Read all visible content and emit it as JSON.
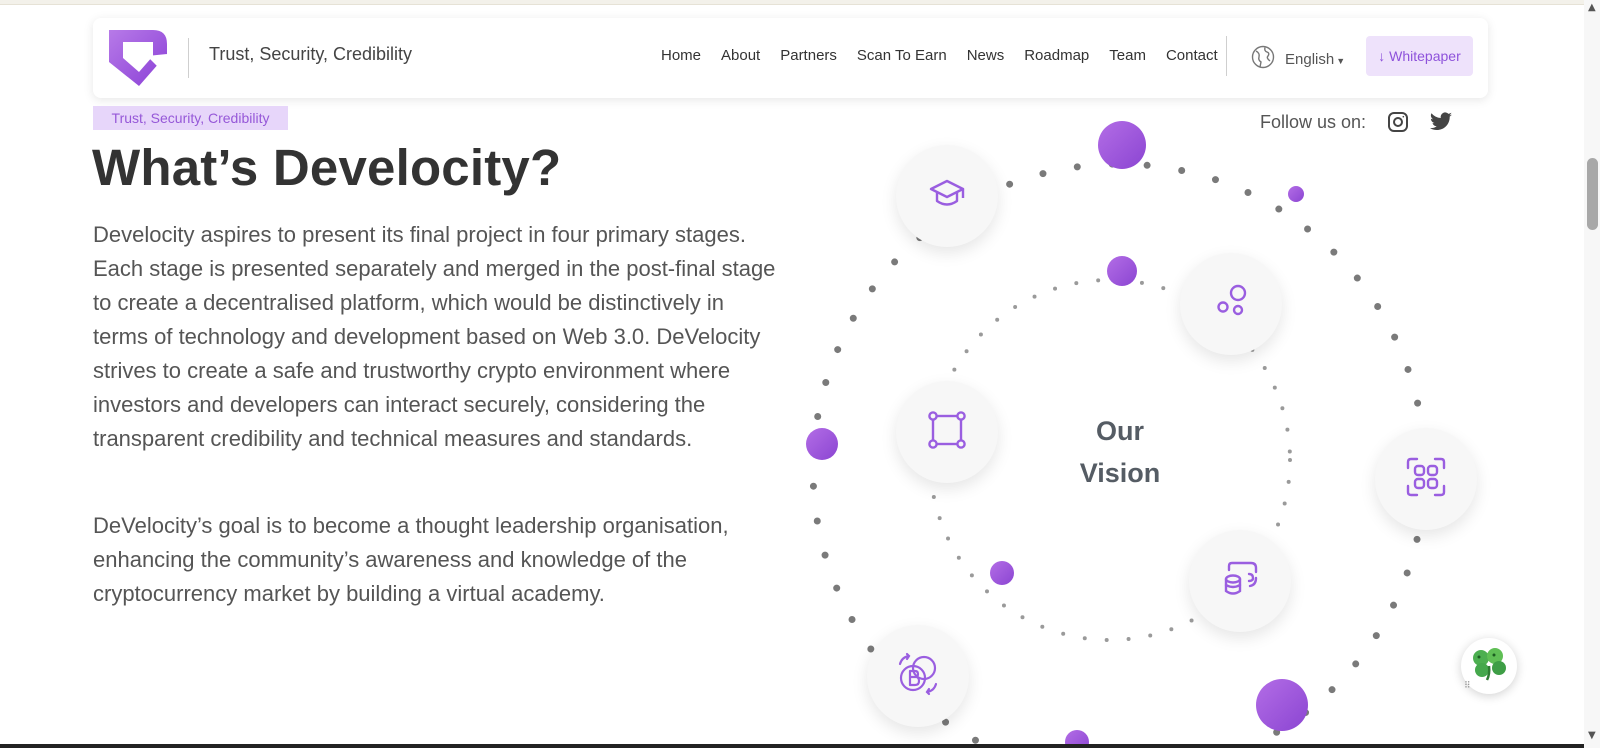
{
  "header": {
    "tagline": "Trust, Security, Credibility",
    "nav": [
      "Home",
      "About",
      "Partners",
      "Scan To Earn",
      "News",
      "Roadmap",
      "Team",
      "Contact"
    ],
    "language": "English",
    "whitepaper": "↓ Whitepaper"
  },
  "hero": {
    "badge": "Trust, Security, Credibility",
    "title": "What’s Develocity?",
    "paragraph1": "Develocity aspires to present its final project in four primary stages. Each stage is presented separately and merged in the post-final stage to create a decentralised platform, which would be distinctively in terms of technology and development based on Web 3.0. DeVelocity strives to create a safe and trustworthy crypto environment where investors and developers can interact securely, considering the transparent credibility and technical measures and standards.",
    "paragraph2": "DeVelocity’s goal is to become a thought leadership organisation, enhancing the community’s awareness and knowledge of the cryptocurrency market by building a virtual academy."
  },
  "social": {
    "label": "Follow us on:",
    "icons": [
      "instagram-icon",
      "twitter-icon"
    ]
  },
  "vision": {
    "line1": "Our",
    "line2": "Vision",
    "icons": [
      "graduation-cap-icon",
      "bubbles-icon",
      "nodes-square-icon",
      "apps-grid-icon",
      "coins-transfer-icon",
      "bitcoin-exchange-icon"
    ]
  },
  "colors": {
    "accent": "#9a5ee0",
    "accent_light": "#eee2fb",
    "text": "#555555",
    "heading": "#333333"
  }
}
